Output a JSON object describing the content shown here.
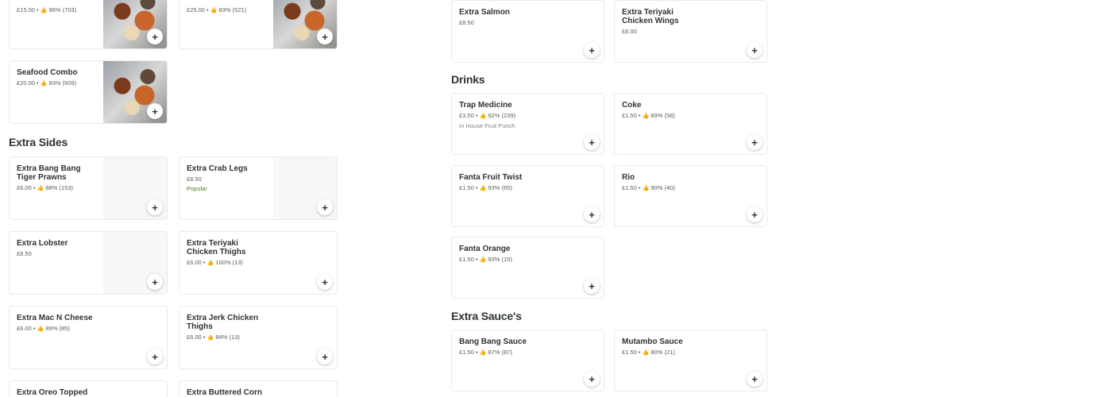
{
  "left": {
    "top_cards": [
      {
        "price": "£15.00",
        "rating": "86% (703)"
      },
      {
        "price": "£25.00",
        "rating": "83% (521)"
      }
    ],
    "seafood": {
      "title": "Seafood Combo",
      "price": "£20.00",
      "rating": "83% (609)"
    },
    "extra_sides_title": "Extra Sides",
    "sides": [
      {
        "title": "Extra Bang Bang Tiger Prawns",
        "price": "£6.00",
        "rating": "88% (153)"
      },
      {
        "title": "Extra Crab Legs",
        "price": "£8.50",
        "popular": "Popular"
      },
      {
        "title": "Extra Lobster",
        "price": "£8.50"
      },
      {
        "title": "Extra Teriyaki Chicken Thighs",
        "price": "£6.00",
        "rating": "100% (13)"
      },
      {
        "title": "Extra Mac N Cheese",
        "price": "£6.00",
        "rating": "89% (85)"
      },
      {
        "title": "Extra Jerk Chicken Thighs",
        "price": "£6.00",
        "rating": "84% (13)"
      },
      {
        "title": "Extra Oreo Topped"
      },
      {
        "title": "Extra Buttered Corn"
      }
    ]
  },
  "right": {
    "top": [
      {
        "title": "Extra Salmon",
        "price": "£8.50"
      },
      {
        "title": "Extra Teriyaki Chicken Wings",
        "price": "£6.00"
      }
    ],
    "drinks_title": "Drinks",
    "drinks": [
      {
        "title": "Trap Medicine",
        "price": "£3.50",
        "rating": "92% (239)",
        "desc": "In House Fruit Punch"
      },
      {
        "title": "Coke",
        "price": "£1.50",
        "rating": "89% (58)"
      },
      {
        "title": "Fanta Fruit Twist",
        "price": "£1.50",
        "rating": "93% (65)"
      },
      {
        "title": "Rio",
        "price": "£1.50",
        "rating": "90% (40)"
      },
      {
        "title": "Fanta Orange",
        "price": "£1.50",
        "rating": "93% (15)"
      }
    ],
    "sauces_title": "Extra Sauce's",
    "sauces": [
      {
        "title": "Bang Bang Sauce",
        "price": "£1.50",
        "rating": "87% (87)"
      },
      {
        "title": "Mutambo Sauce",
        "price": "£1.50",
        "rating": "80% (21)"
      }
    ]
  },
  "labels": {
    "separator": " • ",
    "add": "+",
    "thumb": "👍"
  },
  "colors": {
    "text": "#2e3333",
    "muted": "#585c5c",
    "border": "#e8ebeb",
    "popular": "#4d7c1b"
  }
}
